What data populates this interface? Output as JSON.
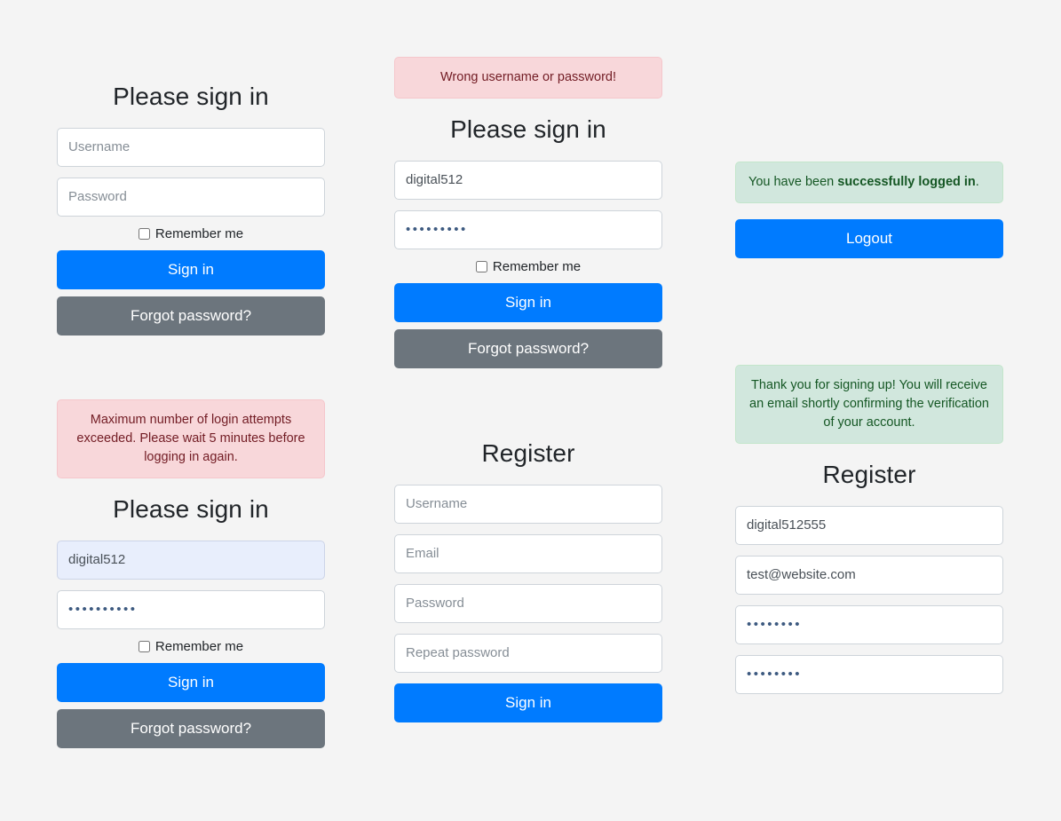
{
  "page": {
    "background_color": "#f4f4f4",
    "accent_color": "#007bff",
    "secondary_color": "#6c757d",
    "danger_bg": "#f8d7da",
    "danger_text": "#721c24",
    "success_bg": "#d1e7dd",
    "success_text": "#155724",
    "autofill_bg": "#e8eefc"
  },
  "common": {
    "signin_title": "Please sign in",
    "register_title": "Register",
    "remember_me": "Remember me",
    "signin_button": "Sign in",
    "forgot_button": "Forgot password?",
    "logout_button": "Logout",
    "placeholder_username": "Username",
    "placeholder_password": "Password",
    "placeholder_email": "Email",
    "placeholder_repeat_password": "Repeat password"
  },
  "left_column": {
    "signin_empty": {
      "title": "Please sign in",
      "username_value": "",
      "username_placeholder": "Username",
      "password_value": "",
      "password_placeholder": "Password",
      "remember_label": "Remember me",
      "remember_checked": false,
      "primary_label": "Sign in",
      "secondary_label": "Forgot password?"
    },
    "signin_locked": {
      "alert": "Maximum number of login attempts exceeded. Please wait 5 minutes before logging in again.",
      "title": "Please sign in",
      "username_value": "digital512",
      "password_value": "••••••••••",
      "remember_label": "Remember me",
      "remember_checked": false,
      "primary_label": "Sign in",
      "secondary_label": "Forgot password?"
    }
  },
  "middle_column": {
    "signin_error": {
      "alert": "Wrong username or password!",
      "title": "Please sign in",
      "username_value": "digital512",
      "password_value": "•••••••••",
      "remember_label": "Remember me",
      "remember_checked": false,
      "primary_label": "Sign in",
      "secondary_label": "Forgot password?"
    },
    "register_empty": {
      "title": "Register",
      "username_placeholder": "Username",
      "email_placeholder": "Email",
      "password_placeholder": "Password",
      "repeat_password_placeholder": "Repeat password",
      "primary_label": "Sign in"
    }
  },
  "right_column": {
    "logged_in": {
      "alert_prefix": "You have been ",
      "alert_strong": "successfully logged in",
      "alert_suffix": ".",
      "logout_label": "Logout"
    },
    "registered": {
      "alert": "Thank you for signing up! You will receive an email shortly confirming the verification of your account.",
      "title": "Register",
      "username_value": "digital512555",
      "email_value": "test@website.com",
      "password_value": "••••••••",
      "repeat_password_value": "••••••••"
    }
  }
}
